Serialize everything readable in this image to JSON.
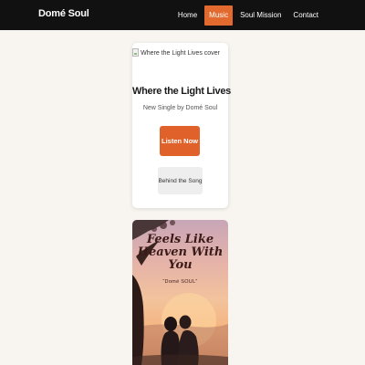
{
  "header": {
    "brand": "Domé Soul",
    "nav": [
      {
        "label": "Home",
        "active": false
      },
      {
        "label": "Music",
        "active": true
      },
      {
        "label": "Soul Mission",
        "active": false
      },
      {
        "label": "Contact",
        "active": false
      }
    ]
  },
  "single": {
    "cover_alt": "Where the Light Lives cover",
    "title": "Where the Light Lives",
    "subtitle": "New Single by Domé Soul",
    "listen_label": "Listen Now",
    "behind_label": "Behind the Song"
  },
  "artwork": {
    "title_line1": "Feels Like",
    "title_line2": "Heaven With You",
    "artist": "“Domé SOUL”"
  },
  "colors": {
    "header_bg": "#111111",
    "accent": "#e36a2e",
    "page_bg": "#f8f5f0"
  }
}
